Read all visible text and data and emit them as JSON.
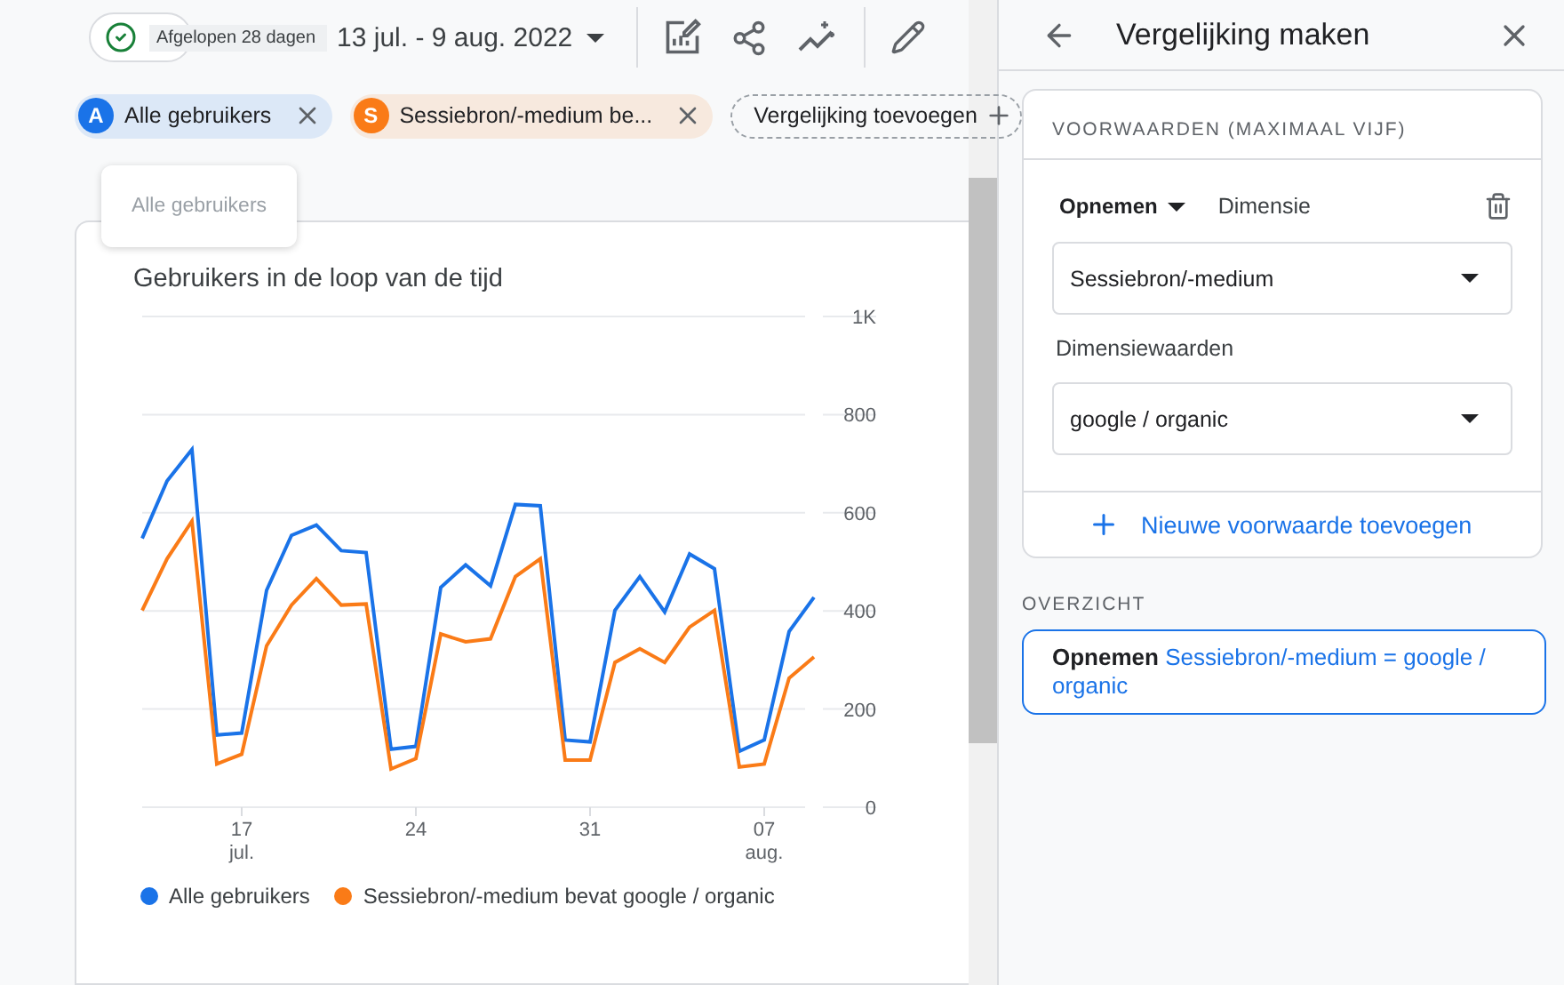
{
  "toolbar": {
    "period_label": "Afgelopen 28 dagen",
    "date_range": "13 jul. - 9 aug. 2022"
  },
  "comparisons": [
    {
      "badge": "A",
      "label": "Alle gebruikers",
      "color": "#1a73e8"
    },
    {
      "badge": "S",
      "label": "Sessiebron/-medium be...",
      "color": "#fa7b17"
    }
  ],
  "add_comparison": "Vergelijking toevoegen",
  "tooltip": "Alle gebruikers",
  "card": {
    "title": "Gebruikers in de loop van de tijd",
    "chart_data": {
      "type": "line",
      "categories": [
        null,
        null,
        null,
        null,
        "17 jul.",
        null,
        null,
        null,
        null,
        null,
        null,
        "24",
        null,
        null,
        null,
        null,
        null,
        null,
        "31",
        null,
        null,
        null,
        null,
        null,
        null,
        "07 aug.",
        null,
        null
      ],
      "ylim": [
        0,
        1000
      ],
      "grid": true,
      "yticks": [
        0,
        200,
        400,
        600,
        800,
        {
          "value": 1000,
          "label": "1K"
        }
      ],
      "series": [
        {
          "name": "Alle gebruikers",
          "color": "#1a73e8",
          "values": [
            548,
            665,
            729,
            147,
            151,
            442,
            554,
            575,
            523,
            519,
            118,
            124,
            448,
            494,
            451,
            617,
            614,
            137,
            133,
            401,
            470,
            398,
            516,
            486,
            114,
            137,
            358,
            428
          ]
        },
        {
          "name": "Sessiebron/-medium bevat google / organic",
          "color": "#fa7b17",
          "values": [
            401,
            506,
            583,
            88,
            108,
            329,
            412,
            466,
            412,
            414,
            78,
            99,
            353,
            337,
            343,
            470,
            506,
            96,
            96,
            295,
            323,
            295,
            367,
            401,
            82,
            88,
            263,
            306
          ]
        }
      ]
    }
  },
  "panel": {
    "title": "Vergelijking maken",
    "conditions_header": "VOORWAARDEN (MAXIMAAL VIJF)",
    "condition": {
      "mode": "Opnemen",
      "dimension_label": "Dimensie",
      "dimension": "Sessiebron/-medium",
      "values_label": "Dimensiewaarden",
      "value": "google / organic"
    },
    "add_condition": "Nieuwe voorwaarde toevoegen",
    "overview_header": "OVERZICHT",
    "summary": {
      "mode": "Opnemen",
      "text": "Sessiebron/-medium = google / organic"
    }
  }
}
